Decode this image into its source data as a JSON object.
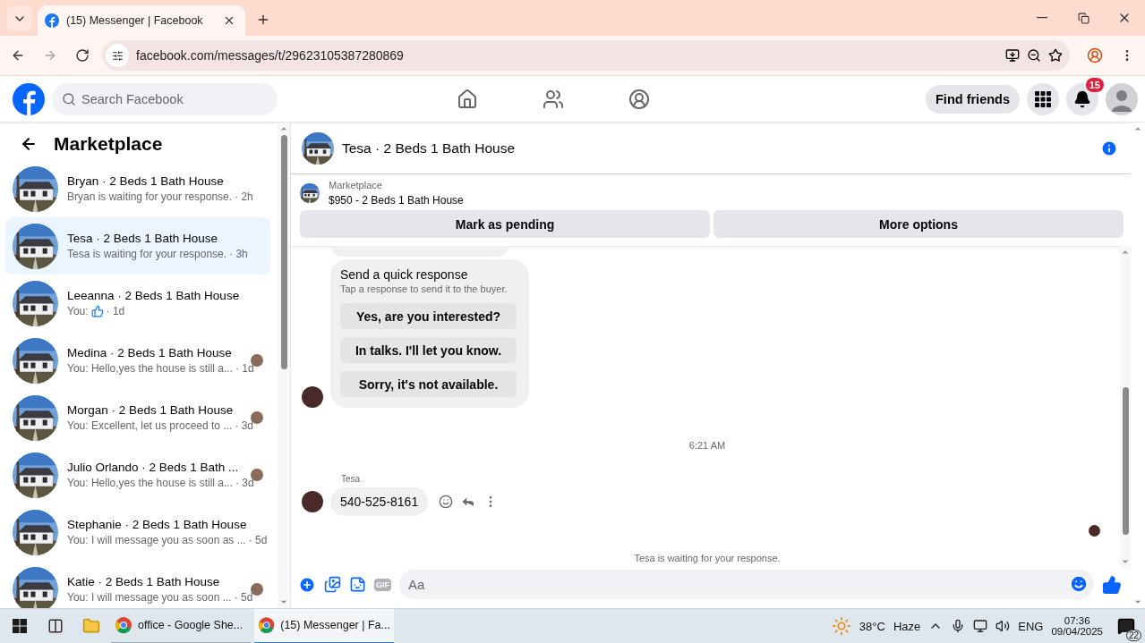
{
  "browser": {
    "tabs": [
      {
        "title": "(15) Messenger | Facebook",
        "selected": true
      }
    ],
    "url": "facebook.com/messages/t/29623105387280869"
  },
  "header": {
    "search_placeholder": "Search Facebook",
    "find_friends": "Find friends",
    "notification_count": "15"
  },
  "sidebar": {
    "title": "Marketplace",
    "conversations": [
      {
        "title": "Bryan · 2 Beds 1 Bath House",
        "preview": "Bryan is waiting for your response.",
        "time": "· 2h",
        "selected": false,
        "like": false,
        "seen": false
      },
      {
        "title": "Tesa · 2 Beds 1 Bath House",
        "preview": "Tesa is waiting for your response.",
        "time": "· 3h",
        "selected": true,
        "like": false,
        "seen": false
      },
      {
        "title": "Leeanna · 2 Beds 1 Bath House",
        "preview": "You:",
        "time": "· 1d",
        "selected": false,
        "like": true,
        "seen": false
      },
      {
        "title": "Medina · 2 Beds 1 Bath House",
        "preview": "You: Hello,yes the house is still a...",
        "time": "· 1d",
        "selected": false,
        "like": false,
        "seen": true
      },
      {
        "title": "Morgan · 2 Beds 1 Bath House",
        "preview": "You: Excellent, let us proceed to ...",
        "time": "· 3d",
        "selected": false,
        "like": false,
        "seen": true
      },
      {
        "title": "Julio Orlando · 2 Beds 1 Bath ...",
        "preview": "You: Hello,yes the house is still a...",
        "time": "· 3d",
        "selected": false,
        "like": false,
        "seen": true
      },
      {
        "title": "Stephanie · 2 Beds 1 Bath House",
        "preview": "You: I will message you as soon as ...",
        "time": "· 5d",
        "selected": false,
        "like": false,
        "seen": false
      },
      {
        "title": "Katie · 2 Beds 1 Bath House",
        "preview": "You: I will message you as soon ...",
        "time": "· 5d",
        "selected": false,
        "like": false,
        "seen": true
      }
    ]
  },
  "chat": {
    "title": "Tesa · 2 Beds 1 Bath House",
    "listing_label": "Marketplace",
    "listing": "$950 - 2 Beds 1 Bath House",
    "actions": [
      "Mark as pending",
      "More options"
    ],
    "quick_response": {
      "title": "Send a quick response",
      "subtitle": "Tap a response to send it to the buyer.",
      "options": [
        "Yes, are you interested?",
        "In talks. I'll let you know.",
        "Sorry, it's not available."
      ]
    },
    "timestamp": "6:21 AM",
    "sender": "Tesa",
    "message": "540-525-8161",
    "status": "Tesa is waiting for your response.",
    "composer_placeholder": "Aa",
    "gif_label": "GIF"
  },
  "taskbar": {
    "apps": [
      {
        "label": "office - Google She...",
        "selected": false
      },
      {
        "label": "(15) Messenger | Fa...",
        "selected": true
      }
    ],
    "temperature": "38°C",
    "weather": "Haze",
    "language": "ENG",
    "time": "07:36",
    "date": "09/04/2025",
    "notifications": "22"
  }
}
